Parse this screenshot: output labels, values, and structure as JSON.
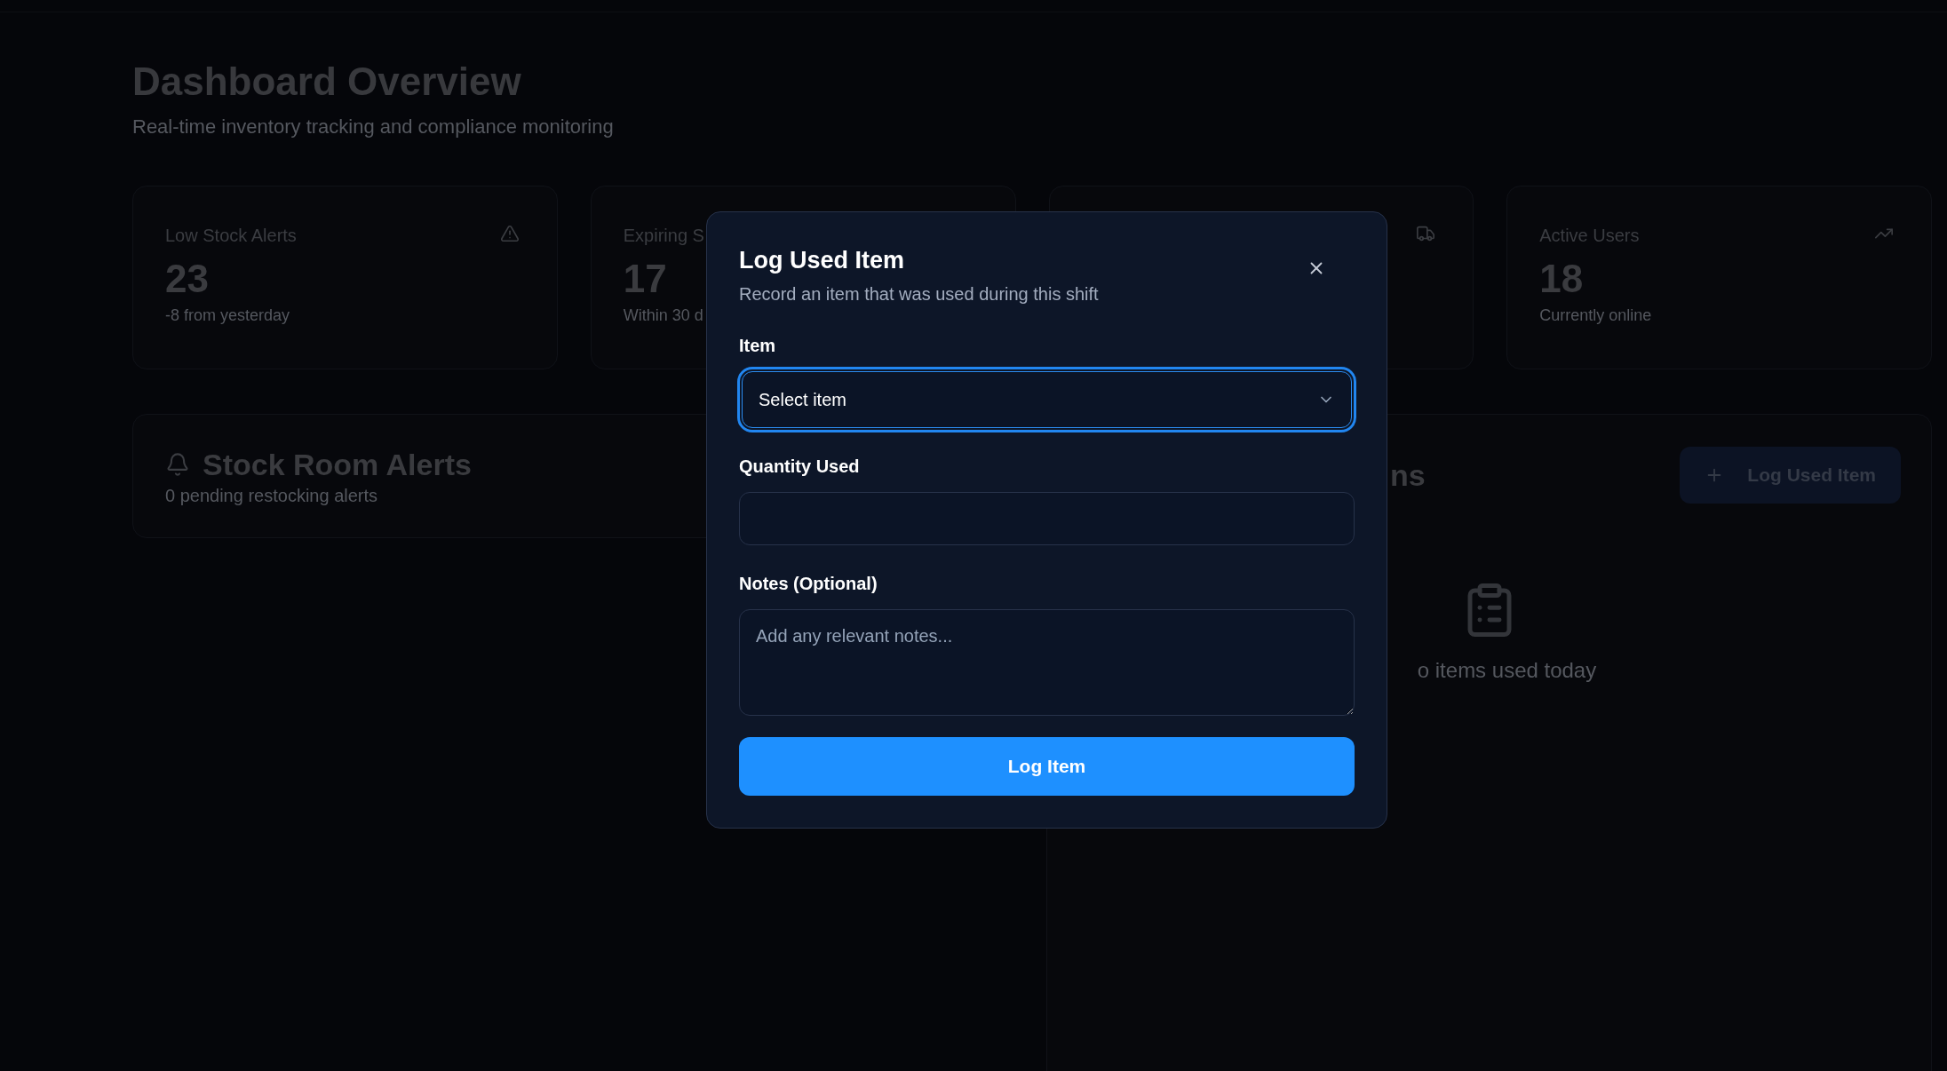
{
  "header": {
    "title": "Dashboard Overview",
    "subtitle": "Real-time inventory tracking and compliance monitoring"
  },
  "stat_cards": [
    {
      "kind": "stat",
      "label": "Low Stock Alerts",
      "value": "23",
      "note": "-8 from yesterday"
    },
    {
      "kind": "stat",
      "label": "Expiring S",
      "value": "17",
      "note": "Within 30 d"
    },
    {
      "kind": "covered"
    },
    {
      "kind": "stat",
      "label": "Active Users",
      "value": "18",
      "note": "Currently online"
    }
  ],
  "alerts_panel": {
    "title": "Stock Room Alerts",
    "subtitle": "0 pending restocking alerts"
  },
  "usage_panel": {
    "title": "ns",
    "button": "Log Used Item",
    "empty_text": "o items used today"
  },
  "dialog": {
    "title": "Log Used Item",
    "subtitle": "Record an item that was used during this shift",
    "fields": [
      {
        "kind": "select",
        "label": "Item",
        "value": "Select item",
        "focused": true
      },
      {
        "kind": "input",
        "label": "Quantity Used",
        "focused": false
      },
      {
        "kind": "textarea",
        "label": "Notes (Optional)",
        "placeholder": "Add any relevant notes...",
        "focused": false
      }
    ],
    "submit": "Log Item"
  }
}
